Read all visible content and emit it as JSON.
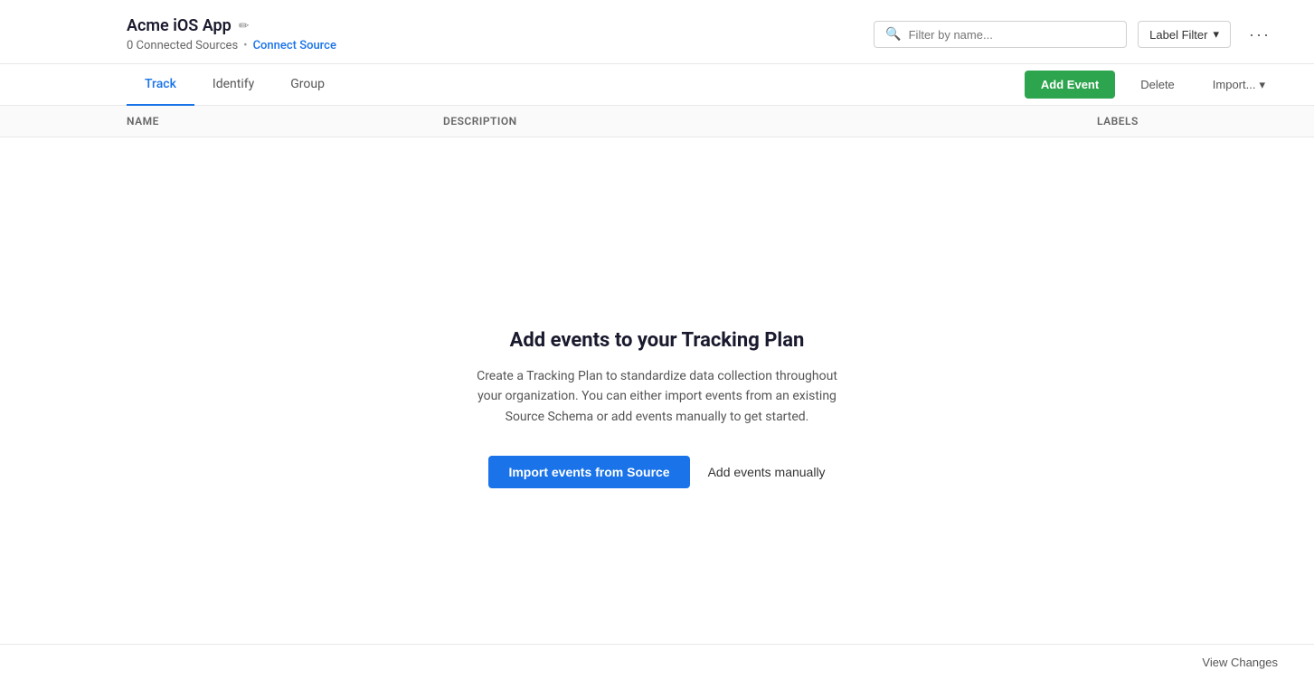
{
  "header": {
    "app_title": "Acme iOS App",
    "connected_sources_label": "0 Connected Sources",
    "dot": "•",
    "connect_source_label": "Connect Source",
    "search_placeholder": "Filter by name...",
    "label_filter_label": "Label Filter",
    "more_options_label": "···"
  },
  "tabs": {
    "track_label": "Track",
    "identify_label": "Identify",
    "group_label": "Group",
    "add_event_label": "Add Event",
    "delete_label": "Delete",
    "import_label": "Import..."
  },
  "table": {
    "col_name": "Name",
    "col_description": "Description",
    "col_labels": "Labels"
  },
  "empty_state": {
    "title": "Add events to your Tracking Plan",
    "description": "Create a Tracking Plan to standardize data collection throughout your organization. You can either import events from an existing Source Schema or add events manually to get started.",
    "import_btn_label": "Import events from Source",
    "add_manually_label": "Add events manually"
  },
  "footer": {
    "view_changes_label": "View Changes"
  },
  "icons": {
    "edit": "✏",
    "search": "🔍",
    "chevron_down": "▾"
  }
}
